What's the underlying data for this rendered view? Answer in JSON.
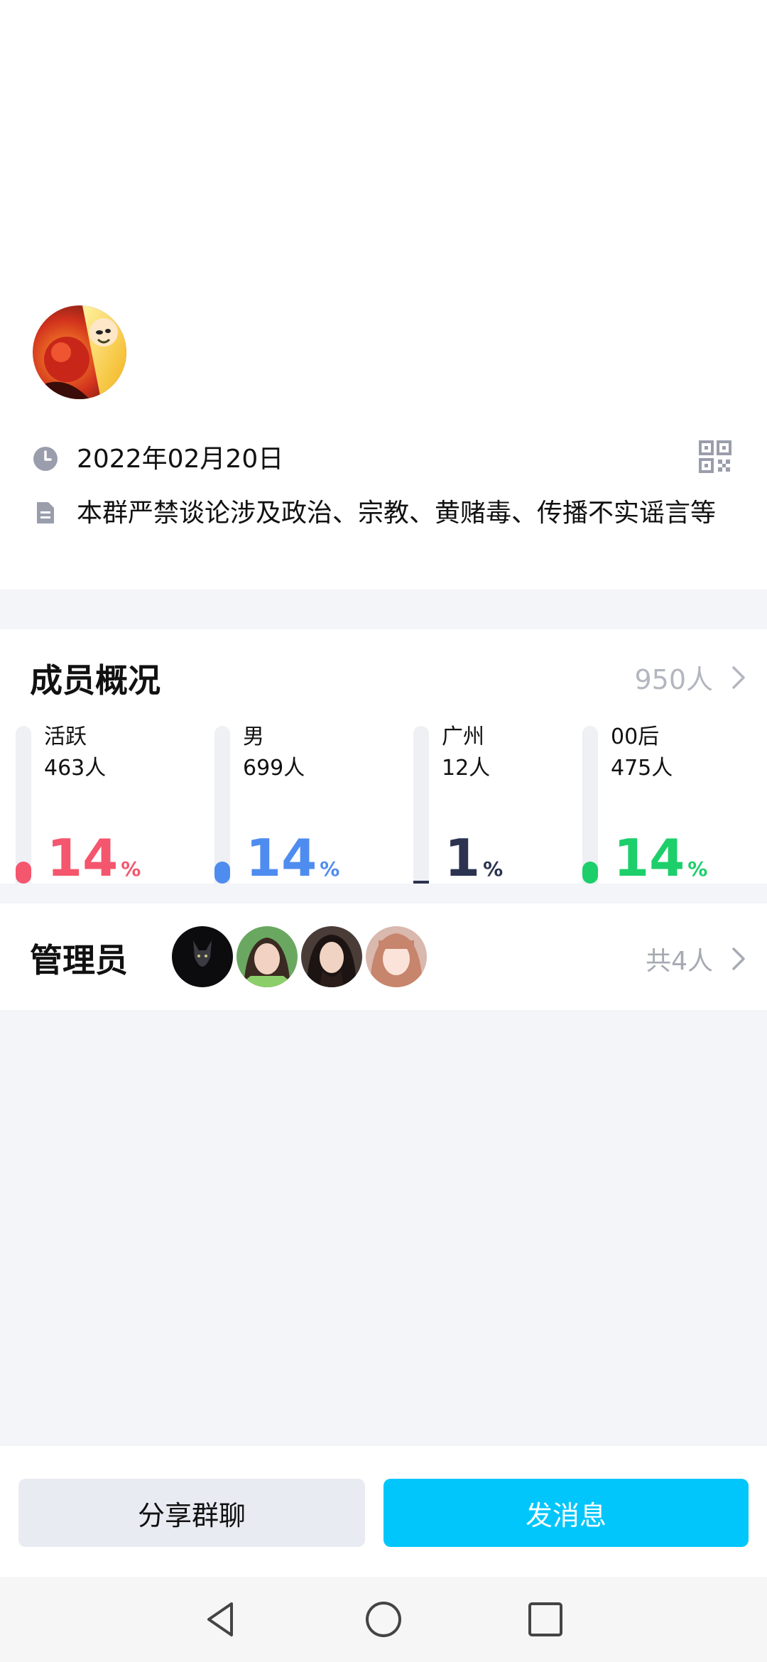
{
  "group": {
    "created_date": "2022年02月20日",
    "notice": "本群严禁谈论涉及政治、宗教、黄赌毒、传播不实谣言等"
  },
  "members": {
    "title": "成员概况",
    "total": "950人",
    "stats": [
      {
        "label": "活跃",
        "count": "463人",
        "percent": "14",
        "sign": "%",
        "color": "#f4566d",
        "fill": 0.14
      },
      {
        "label": "男",
        "count": "699人",
        "percent": "14",
        "sign": "%",
        "color": "#4f8cf0",
        "fill": 0.14
      },
      {
        "label": "广州",
        "count": "12人",
        "percent": "1",
        "sign": "%",
        "color": "#2b3350",
        "fill": 0.01
      },
      {
        "label": "00后",
        "count": "475人",
        "percent": "14",
        "sign": "%",
        "color": "#1ccf6a",
        "fill": 0.14
      }
    ]
  },
  "admins": {
    "title": "管理员",
    "count": "共4人"
  },
  "actions": {
    "share_label": "分享群聊",
    "send_label": "发消息"
  },
  "colors": {
    "accent": "#00c6fb",
    "background": "#f4f5f9",
    "muted_text": "#b3b6bf"
  },
  "icons": {
    "date": "clock-icon",
    "notice": "document-icon",
    "qr": "qr-code-icon",
    "chevron": "chevron-right-icon"
  }
}
